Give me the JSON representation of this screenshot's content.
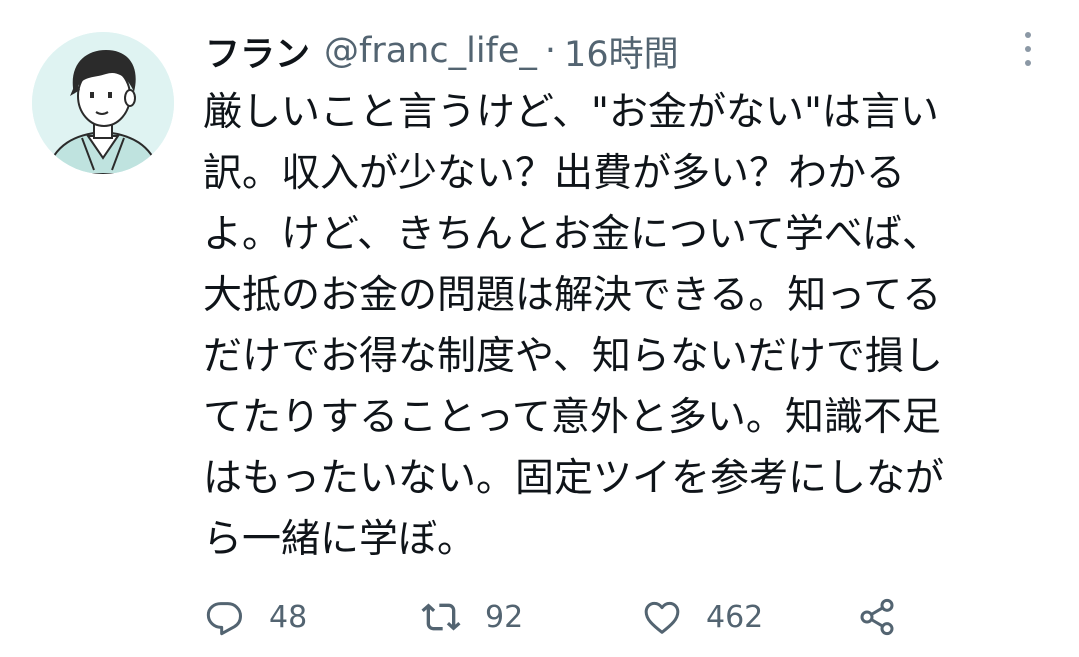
{
  "tweet": {
    "display_name": "フラン",
    "handle": "@franc_life_",
    "separator": "·",
    "time": "16時間",
    "body_lines": [
      "厳しいこと言うけど、\"お金がない\"は言い",
      "訳。収入が少ない？出費が多い？わかる",
      "よ。けど、きちんとお金について学べば、",
      "大抵のお金の問題は解決できる。知ってる",
      "だけでお得な制度や、知らないだけで損し",
      "てたりすることって意外と多い。知識不足",
      "はもったいない。固定ツイを参考にしなが",
      "ら一緒に学ぼ。"
    ],
    "counts": {
      "replies": "48",
      "retweets": "92",
      "likes": "462"
    }
  },
  "icons": {
    "more": "more-vertical-icon",
    "reply": "reply-icon",
    "retweet": "retweet-icon",
    "like": "heart-icon",
    "share": "share-icon"
  },
  "colors": {
    "text": "#0f1419",
    "secondary": "#536471",
    "avatar_bg": "#dff3f2"
  }
}
